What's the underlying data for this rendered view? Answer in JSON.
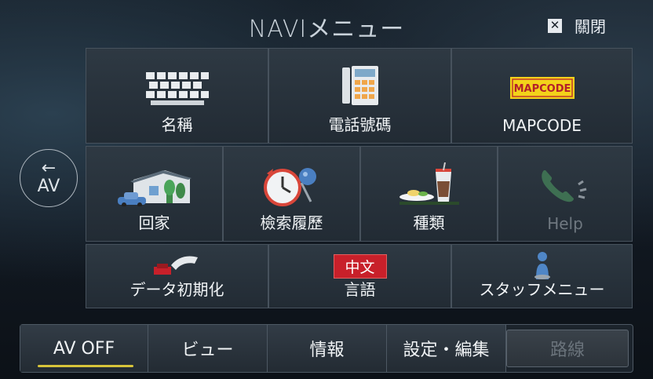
{
  "header": {
    "title": "NAVIメニュー",
    "close_label": "關閉"
  },
  "back": {
    "label": "AV"
  },
  "tiles": [
    {
      "label": "名稱",
      "icon": "keyboard-icon",
      "enabled": true
    },
    {
      "label": "電話號碼",
      "icon": "phone-icon",
      "enabled": true
    },
    {
      "label": "MAPCODE",
      "icon": "mapcode-logo",
      "logo_text": "MAPCODE",
      "enabled": true
    },
    {
      "label": "回家",
      "icon": "home-icon",
      "enabled": true
    },
    {
      "label": "檢索履歷",
      "icon": "history-icon",
      "enabled": true
    },
    {
      "label": "種類",
      "icon": "category-icon",
      "enabled": true
    },
    {
      "label": "Help",
      "icon": "help-phone-icon",
      "enabled": false
    },
    {
      "label": "データ初期化",
      "icon": "reset-icon",
      "enabled": true
    },
    {
      "label": "言語",
      "icon": "language-icon",
      "badge": "中文",
      "enabled": true
    },
    {
      "label": "スタッフメニュー",
      "icon": "staff-icon",
      "enabled": true
    }
  ],
  "bottom_bar": [
    {
      "label": "AV OFF",
      "active": true
    },
    {
      "label": "ビュー"
    },
    {
      "label": "情報"
    },
    {
      "label": "設定・編集"
    },
    {
      "label": "路線",
      "enabled": false
    }
  ],
  "colors": {
    "accent": "#d7c43a",
    "badge_red": "#c8202a",
    "mapcode_yellow": "#f3d21a"
  }
}
